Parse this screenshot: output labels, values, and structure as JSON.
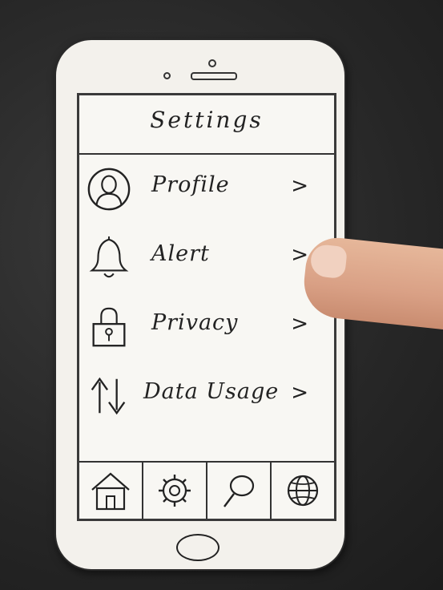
{
  "header": {
    "title": "Settings"
  },
  "menu": {
    "items": [
      {
        "label": "Profile",
        "arrow": ">",
        "icon": "profile-icon"
      },
      {
        "label": "Alert",
        "arrow": ">",
        "icon": "bell-icon"
      },
      {
        "label": "Privacy",
        "arrow": ">",
        "icon": "lock-icon"
      },
      {
        "label": "Data Usage",
        "arrow": ">",
        "icon": "up-down-arrows-icon"
      }
    ]
  },
  "tabbar": {
    "tabs": [
      {
        "icon": "home-icon"
      },
      {
        "icon": "gear-icon"
      },
      {
        "icon": "search-icon"
      },
      {
        "icon": "globe-icon"
      }
    ]
  },
  "colors": {
    "paper": "#f3f1ec",
    "ink": "#222222",
    "background": "#2b2b2b"
  }
}
